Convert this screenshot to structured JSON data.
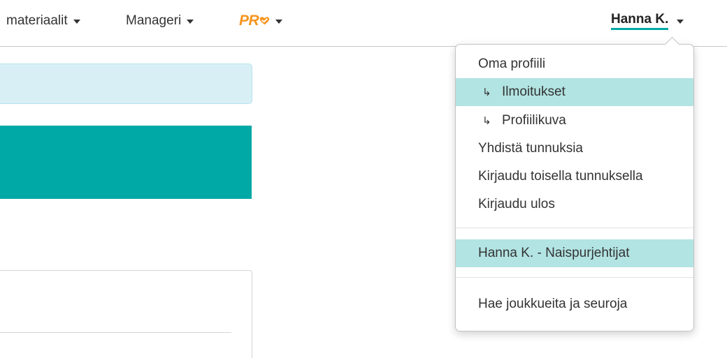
{
  "nav": {
    "materials_label": "materiaalit",
    "manager_label": "Manageri",
    "pro_logo": "PR",
    "user_label": "Hanna K."
  },
  "colors": {
    "accent": "#00a9a5",
    "pro_orange": "#f7941d",
    "highlight": "#b2e4e3",
    "info_box": "#d9eff6"
  },
  "dropdown": {
    "items": [
      {
        "label": "Oma profiili"
      },
      {
        "label": "Ilmoitukset",
        "sub": true,
        "active": true
      },
      {
        "label": "Profiilikuva",
        "sub": true
      },
      {
        "label": "Yhdistä tunnuksia"
      },
      {
        "label": "Kirjaudu toisella tunnuksella"
      },
      {
        "label": "Kirjaudu ulos"
      }
    ],
    "team": {
      "label": "Hanna K. - Naispurjehtijat",
      "active": true
    },
    "search": {
      "label": "Hae joukkueita ja seuroja"
    },
    "sub_arrow": "↳"
  }
}
